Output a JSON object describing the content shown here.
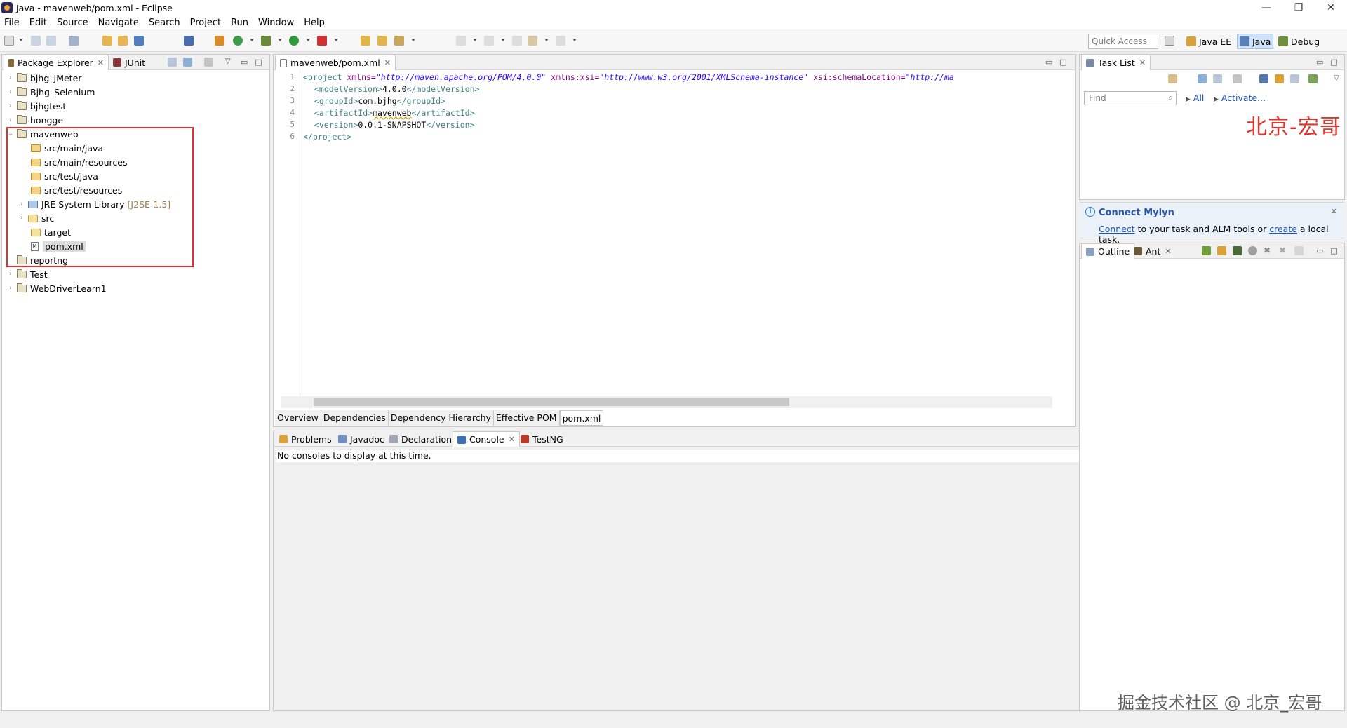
{
  "window": {
    "title": "Java - mavenweb/pom.xml - Eclipse",
    "minimize": "—",
    "maximize": "❐",
    "close": "✕"
  },
  "menu": [
    "File",
    "Edit",
    "Source",
    "Navigate",
    "Search",
    "Project",
    "Run",
    "Window",
    "Help"
  ],
  "toolbar": {
    "quick_access_placeholder": "Quick Access",
    "perspectives": [
      {
        "label": "Java EE",
        "active": false
      },
      {
        "label": "Java",
        "active": true
      },
      {
        "label": "Debug",
        "active": false
      }
    ]
  },
  "package_explorer": {
    "tab_label": "Package Explorer",
    "tab2_label": "JUnit",
    "projects_top": [
      "bjhg_JMeter",
      "Bjhg_Selenium",
      "bjhgtest",
      "hongge"
    ],
    "expanded_project": "mavenweb",
    "children": [
      {
        "label": "src/main/java",
        "type": "pkg"
      },
      {
        "label": "src/main/resources",
        "type": "pkg"
      },
      {
        "label": "src/test/java",
        "type": "pkg"
      },
      {
        "label": "src/test/resources",
        "type": "pkg"
      },
      {
        "label": "JRE System Library",
        "decor": "[J2SE-1.5]",
        "type": "lib"
      },
      {
        "label": "src",
        "type": "folder"
      },
      {
        "label": "target",
        "type": "folder"
      },
      {
        "label": "pom.xml",
        "type": "xml"
      }
    ],
    "projects_bottom": [
      "reportng",
      "Test",
      "WebDriverLearn1"
    ]
  },
  "editor": {
    "tab_label": "mavenweb/pom.xml",
    "lines": [
      {
        "n": "1",
        "tag_open": "<project",
        "attr1": " xmlns=",
        "val1": "\"http://maven.apache.org/POM/4.0.0\"",
        "attr2": " xmlns:xsi=",
        "val2": "\"http://www.w3.org/2001/XMLSchema-instance\"",
        "attr3": " xsi:schemaLocation=",
        "val3": "\"http://ma"
      },
      {
        "n": "2",
        "open": "<modelVersion>",
        "text": "4.0.0",
        "close": "</modelVersion>"
      },
      {
        "n": "3",
        "open": "<groupId>",
        "text": "com.bjhg",
        "close": "</groupId>"
      },
      {
        "n": "4",
        "open": "<artifactId>",
        "text": "mavenweb",
        "close": "</artifactId>"
      },
      {
        "n": "5",
        "open": "<version>",
        "text": "0.0.1-SNAPSHOT",
        "close": "</version>"
      },
      {
        "n": "6",
        "close_project": "</project>"
      }
    ],
    "bottom_tabs": [
      "Overview",
      "Dependencies",
      "Dependency Hierarchy",
      "Effective POM",
      "pom.xml"
    ],
    "active_bottom_tab": "pom.xml"
  },
  "bottom_panel": {
    "tabs": [
      "Problems",
      "Javadoc",
      "Declaration",
      "Console",
      "TestNG"
    ],
    "active_tab": "Console",
    "message": "No consoles to display at this time."
  },
  "task_list": {
    "tab_label": "Task List",
    "find_placeholder": "Find",
    "all_label": "All",
    "activate_label": "Activate..."
  },
  "mylyn": {
    "title": "Connect Mylyn",
    "connect_link": "Connect",
    "text_mid": " to your task and ALM tools or ",
    "create_link": "create",
    "text_end": " a local task."
  },
  "outline": {
    "tab_label": "Outline",
    "tab2_label": "Ant"
  },
  "watermarks": {
    "red": "北京-宏哥",
    "bottom": "掘金技术社区 @ 北京_宏哥"
  },
  "colors": {
    "red_box": "#e03030",
    "accent": "#2a58a8"
  }
}
